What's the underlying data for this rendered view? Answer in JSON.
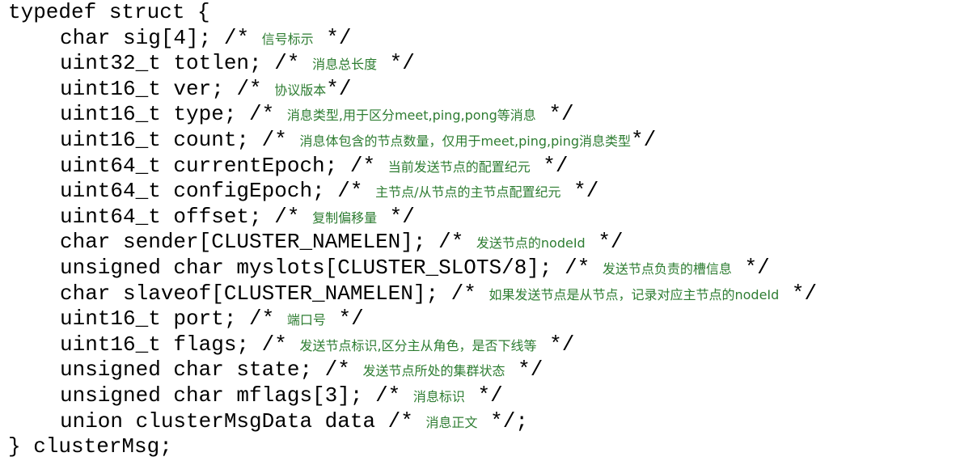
{
  "code": {
    "open": "typedef struct {",
    "fields": [
      {
        "decl": "char sig[4];",
        "pre": " /* ",
        "comment": "信号标示",
        "post": " */"
      },
      {
        "decl": "uint32_t totlen;",
        "pre": " /* ",
        "comment": "消息总长度",
        "post": " */"
      },
      {
        "decl": "uint16_t ver;",
        "pre": " /* ",
        "comment": "协议版本",
        "post": "*/"
      },
      {
        "decl": "uint16_t type;",
        "pre": " /* ",
        "comment": "消息类型,用于区分meet,ping,pong等消息",
        "post": " */"
      },
      {
        "decl": "uint16_t count;",
        "pre": " /* ",
        "comment": "消息体包含的节点数量，仅用于meet,ping,ping消息类型",
        "post": "*/"
      },
      {
        "decl": "uint64_t currentEpoch;",
        "pre": " /* ",
        "comment": "当前发送节点的配置纪元",
        "post": " */"
      },
      {
        "decl": "uint64_t configEpoch;",
        "pre": " /* ",
        "comment": "主节点/从节点的主节点配置纪元",
        "post": " */"
      },
      {
        "decl": "uint64_t offset;",
        "pre": " /* ",
        "comment": "复制偏移量",
        "post": " */"
      },
      {
        "decl": "char sender[CLUSTER_NAMELEN];",
        "pre": " /* ",
        "comment": "发送节点的nodeId",
        "post": " */"
      },
      {
        "decl": "unsigned char myslots[CLUSTER_SLOTS/8];",
        "pre": " /* ",
        "comment": "发送节点负责的槽信息",
        "post": " */"
      },
      {
        "decl": "char slaveof[CLUSTER_NAMELEN];",
        "pre": " /* ",
        "comment": "如果发送节点是从节点，记录对应主节点的nodeId",
        "post": " */"
      },
      {
        "decl": "uint16_t port;",
        "pre": " /* ",
        "comment": "端口号",
        "post": " */"
      },
      {
        "decl": "uint16_t flags;",
        "pre": " /* ",
        "comment": "发送节点标识,区分主从角色，是否下线等",
        "post": " */"
      },
      {
        "decl": "unsigned char state;",
        "pre": " /* ",
        "comment": "发送节点所处的集群状态",
        "post": " */"
      },
      {
        "decl": "unsigned char mflags[3];",
        "pre": " /* ",
        "comment": "消息标识",
        "post": " */"
      },
      {
        "decl": "union clusterMsgData data",
        "pre": " /* ",
        "comment": "消息正文",
        "post": " */;"
      }
    ],
    "close": "} clusterMsg;"
  },
  "colors": {
    "text": "#000000",
    "comment": "#2e7d32",
    "background": "#ffffff"
  }
}
